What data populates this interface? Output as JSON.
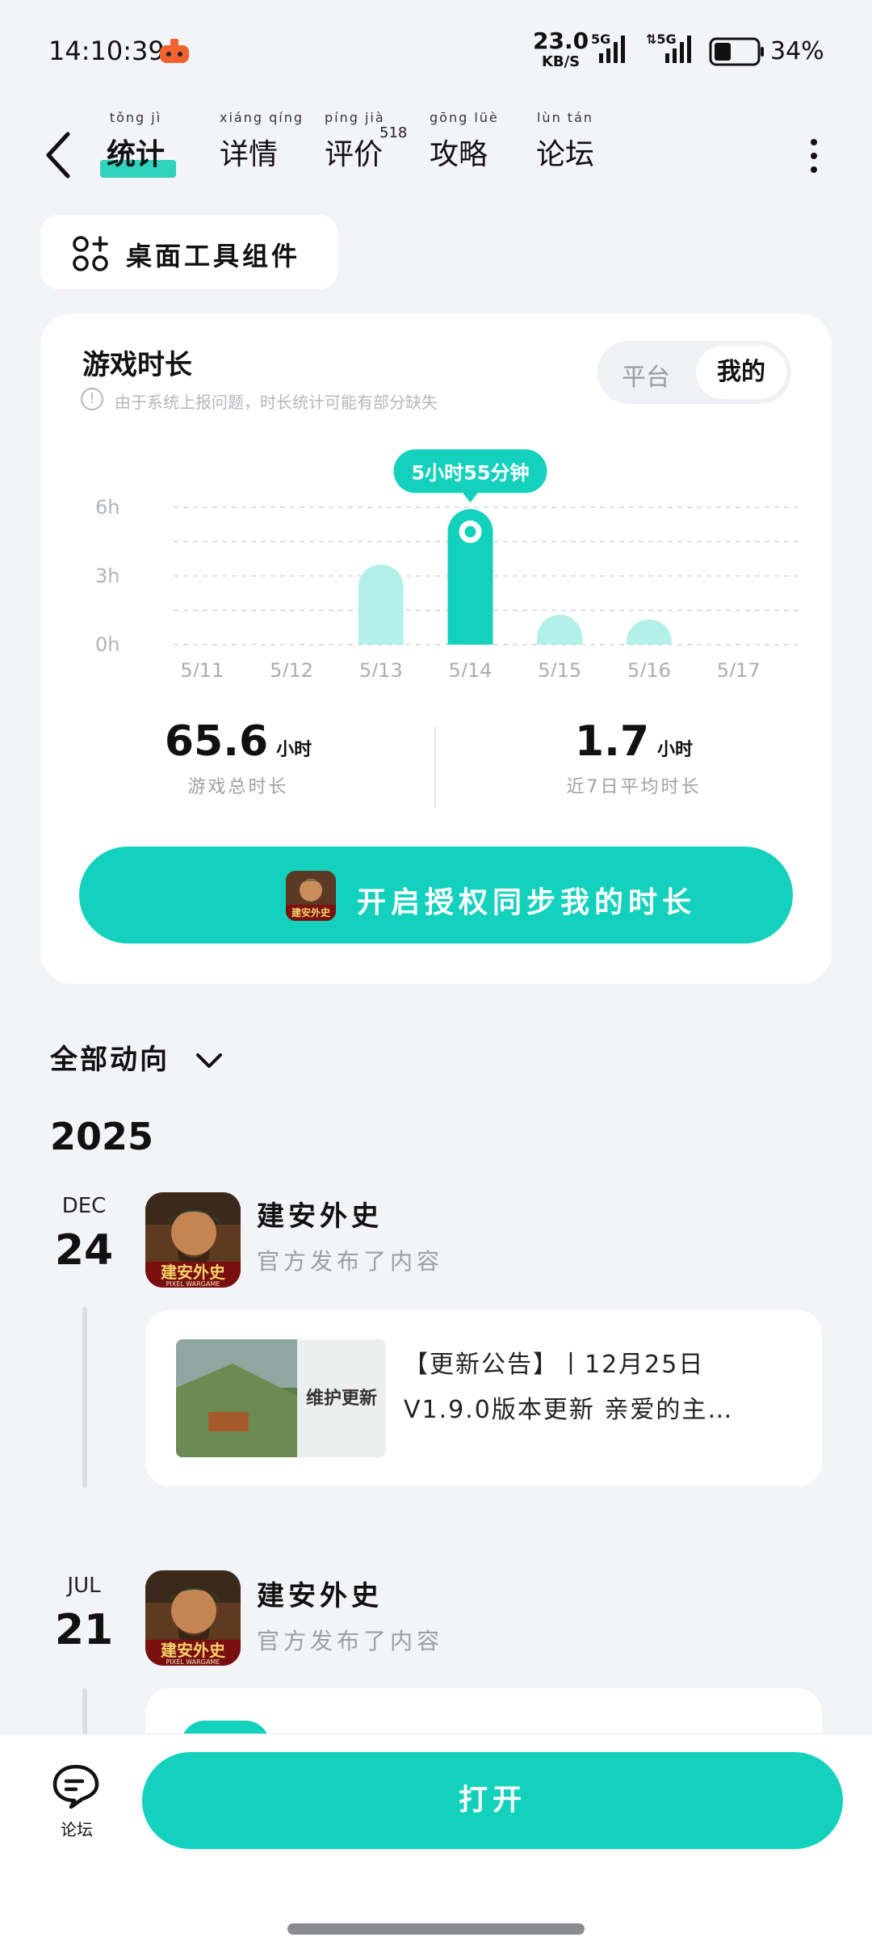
{
  "status_bar": {
    "time": "14:10:39",
    "net_speed": "23.0",
    "net_unit": "KB/S",
    "signal_1": "5G",
    "signal_2": "5G",
    "battery": "34%"
  },
  "nav": {
    "tabs": [
      {
        "label": "统计",
        "pinyin": "tǒng jì",
        "active": true
      },
      {
        "label": "详情",
        "pinyin": "xiáng qíng"
      },
      {
        "label": "评价",
        "pinyin": "píng jià",
        "count": "518"
      },
      {
        "label": "攻略",
        "pinyin": "gōng lüè"
      },
      {
        "label": "论坛",
        "pinyin": "lùn tán"
      }
    ]
  },
  "widget": {
    "label": "桌面工具组件"
  },
  "stats": {
    "title": "游戏时长",
    "note": "由于系统上报问题，时长统计可能有部分缺失",
    "toggle": {
      "platform": "平台",
      "mine": "我的",
      "selected": "mine"
    },
    "tooltip": "5小时55分钟",
    "total_value": "65.6",
    "total_unit": "小时",
    "total_label": "游戏总时长",
    "avg_value": "1.7",
    "avg_unit": "小时",
    "avg_label": "近7日平均时长",
    "sync_label": "开启授权同步我的时长"
  },
  "chart_data": {
    "type": "bar",
    "categories": [
      "5/11",
      "5/12",
      "5/13",
      "5/14",
      "5/15",
      "5/16",
      "5/17"
    ],
    "values": [
      0,
      0,
      3.5,
      5.92,
      1.3,
      1.1,
      0
    ],
    "unit": "h",
    "yticks": [
      "0h",
      "3h",
      "6h"
    ],
    "ylim": [
      0,
      6
    ],
    "highlight_index": 3,
    "grid": true,
    "colors": {
      "highlight": "#13d1bc",
      "normal": "#b2f0e8",
      "grid": "#dedfe3"
    }
  },
  "feed": {
    "filter": "全部动向",
    "year": "2025",
    "entries": [
      {
        "month": "DEC",
        "day": "24",
        "game": "建安外史",
        "sub": "官方发布了内容",
        "post_line1": "【更新公告】丨12月25日",
        "post_line2": "V1.9.0版本更新 亲爱的主…",
        "thumb_text": "维护更新"
      },
      {
        "month": "JUL",
        "day": "21",
        "game": "建安外史",
        "sub": "官方发布了内容"
      }
    ]
  },
  "bottom": {
    "forum_label": "论坛",
    "open_label": "打开"
  },
  "colors": {
    "accent": "#13d1bc",
    "background": "#f3f4f8"
  }
}
